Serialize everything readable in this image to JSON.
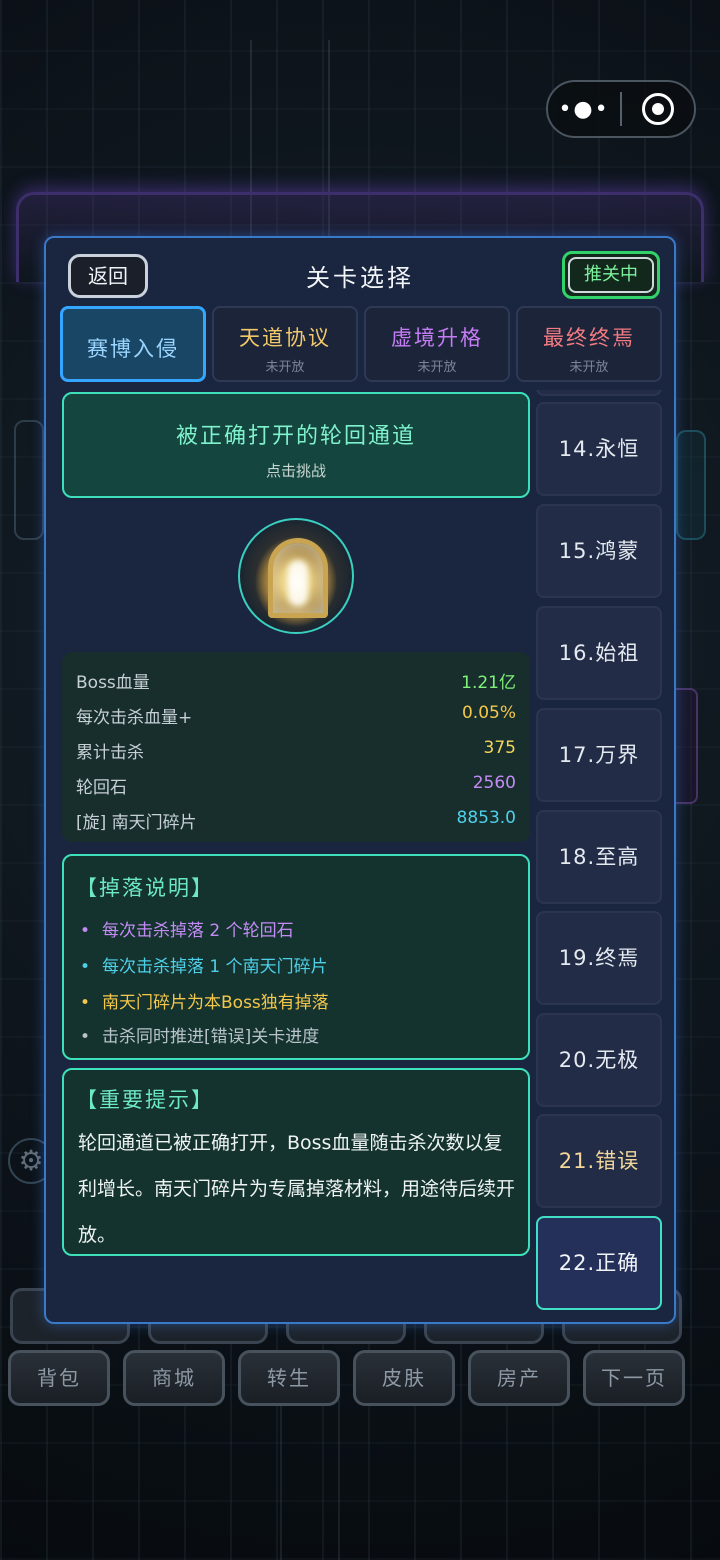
{
  "capsule": {
    "more_icon": "more-dots-icon",
    "close_icon": "target-icon"
  },
  "modal": {
    "back_label": "返回",
    "title": "关卡选择",
    "recommend_label": "推关中"
  },
  "tabs": [
    {
      "name": "赛博入侵",
      "sub": "",
      "color": "#9ad6ff",
      "active": true
    },
    {
      "name": "天道协议",
      "sub": "未开放",
      "color": "#f0c96a",
      "active": false
    },
    {
      "name": "虚境升格",
      "sub": "未开放",
      "color": "#c47cf5",
      "active": false
    },
    {
      "name": "最终终焉",
      "sub": "未开放",
      "color": "#f27a82",
      "active": false
    }
  ],
  "levels": [
    {
      "label": "14.永恒"
    },
    {
      "label": "15.鸿蒙"
    },
    {
      "label": "16.始祖"
    },
    {
      "label": "17.万界"
    },
    {
      "label": "18.至高"
    },
    {
      "label": "19.终焉"
    },
    {
      "label": "20.无极"
    },
    {
      "label": "21.错误"
    },
    {
      "label": "22.正确"
    }
  ],
  "challenge": {
    "title": "被正确打开的轮回通道",
    "subtitle": "点击挑战"
  },
  "stats": [
    {
      "key": "Boss血量",
      "value": "1.21亿",
      "color": "#7ff27a"
    },
    {
      "key": "每次击杀血量+",
      "value": "0.05%",
      "color": "#f5c74a"
    },
    {
      "key": "累计击杀",
      "value": "375",
      "color": "#f5d65a"
    },
    {
      "key": "轮回石",
      "value": "2560",
      "color": "#c38cf5"
    },
    {
      "key": "[旋] 南天门碎片",
      "value": "8853.0",
      "color": "#4fd0ea"
    }
  ],
  "drops": {
    "title": "【掉落说明】",
    "items": [
      {
        "text": "每次击杀掉落 2 个轮回石",
        "color": "#c38cf5"
      },
      {
        "text": "每次击杀掉落 1 个南天门碎片",
        "color": "#4fd0ea"
      },
      {
        "text": "南天门碎片为本Boss独有掉落",
        "color": "#f5c74a"
      },
      {
        "text": "击杀同时推进[错误]关卡进度",
        "color": "#b9c4ca"
      }
    ]
  },
  "tips": {
    "title": "【重要提示】",
    "text": "轮回通道已被正确打开，Boss血量随击杀次数以复利增长。南天门碎片为专属掉落材料，用途待后续开放。"
  },
  "bottom_nav": [
    "背包",
    "商城",
    "转生",
    "皮肤",
    "房产",
    "下一页"
  ]
}
